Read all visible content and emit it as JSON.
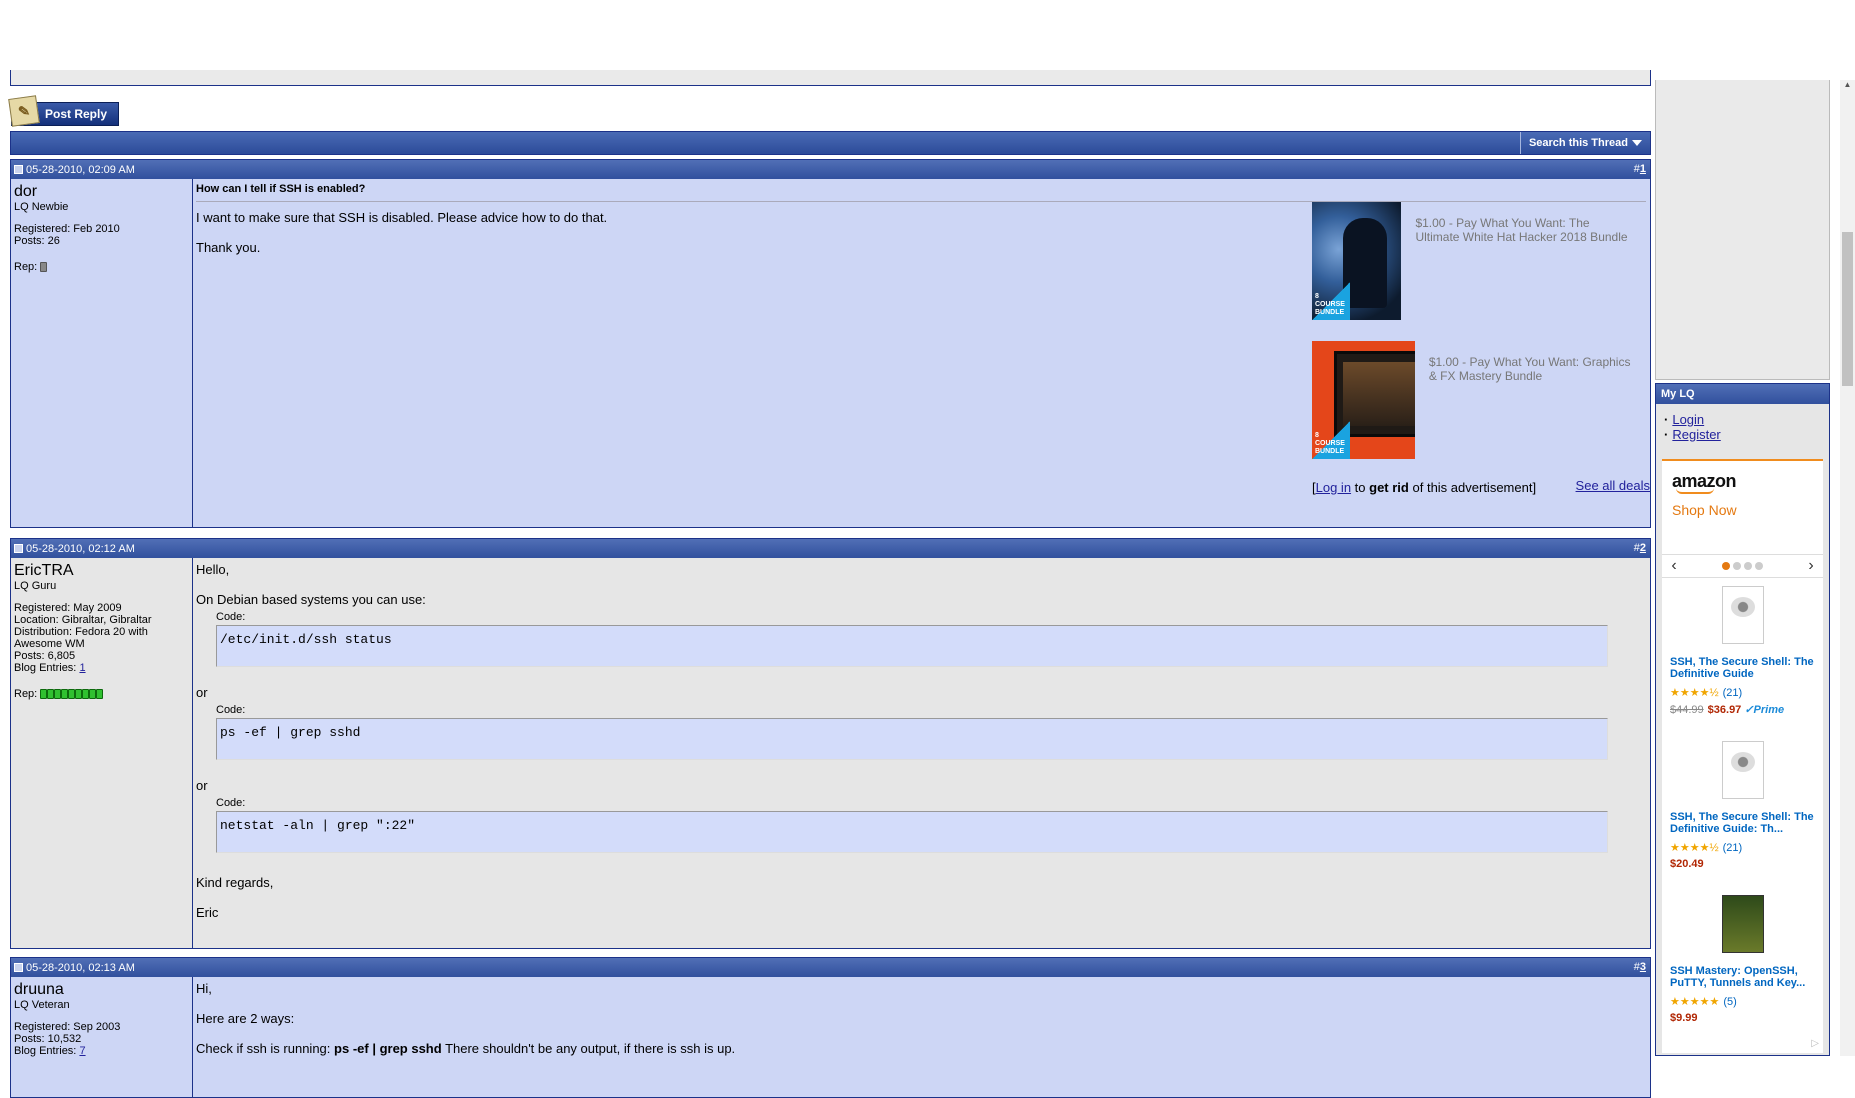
{
  "thread": {
    "post_reply_label": "Post Reply",
    "search_label": "Search this Thread"
  },
  "posts": [
    {
      "date": "05-28-2010, 02:09 AM",
      "number_prefix": "#",
      "number": "1",
      "user": {
        "name": "dor",
        "title": "LQ Newbie",
        "registered": "Registered: Feb 2010",
        "posts": "Posts: 26",
        "rep_label": "Rep:"
      },
      "title": "How can I tell if SSH is enabled?",
      "paragraphs": [
        "I want to make sure that SSH is disabled. Please advice how to do that.",
        "Thank you."
      ]
    },
    {
      "date": "05-28-2010, 02:12 AM",
      "number_prefix": "#",
      "number": "2",
      "user": {
        "name": "EricTRA",
        "title": "LQ Guru",
        "registered": "Registered: May 2009",
        "location": "Location: Gibraltar, Gibraltar",
        "distribution": "Distribution: Fedora 20 with Awesome WM",
        "posts": "Posts: 6,805",
        "blog_label": "Blog Entries:",
        "blog_count": "1",
        "rep_label": "Rep:"
      },
      "greeting": "Hello,",
      "intro": "On Debian based systems you can use:",
      "code_label": "Code:",
      "codes": [
        "/etc/init.d/ssh status",
        "ps -ef | grep sshd",
        "netstat -aln | grep \":22\""
      ],
      "or": "or",
      "closing": "Kind regards,",
      "signature": "Eric"
    },
    {
      "date": "05-28-2010, 02:13 AM",
      "number_prefix": "#",
      "number": "3",
      "user": {
        "name": "druuna",
        "title": "LQ Veteran",
        "registered": "Registered: Sep 2003",
        "posts": "Posts: 10,532",
        "blog_label": "Blog Entries:",
        "blog_count": "7"
      },
      "greeting": "Hi,",
      "line2": "Here are 2 ways:",
      "line3_pre": "Check if ssh is running:",
      "line3_cmd": "ps -ef | grep sshd",
      "line3_post": "There shouldn't be any output, if there is ssh is up."
    }
  ],
  "ads": {
    "items": [
      {
        "text": "$1.00 - Pay What You Want: The Ultimate White Hat Hacker 2018 Bundle",
        "badge": "8 COURSE BUNDLE"
      },
      {
        "text": "$1.00 - Pay What You Want: Graphics & FX Mastery Bundle",
        "badge": "8 COURSE BUNDLE"
      }
    ],
    "login_link": "Log in",
    "to": "to",
    "get_rid": "get rid",
    "of_ad": "of this advertisement]",
    "open_bracket": "[",
    "see_all": "See all deals"
  },
  "sidebar": {
    "mylq_title": "My LQ",
    "links": [
      "Login",
      "Register"
    ],
    "amazon": {
      "logo": "amazon",
      "shop_now": "Shop Now",
      "products": [
        {
          "title": "SSH, The Secure Shell: The Definitive Guide",
          "stars": "★★★★½",
          "reviews": "(21)",
          "old_price": "$44.99",
          "price": "$36.97",
          "prime": "✓Prime"
        },
        {
          "title": "SSH, The Secure Shell: The Definitive Guide: Th...",
          "stars": "★★★★½",
          "reviews": "(21)",
          "price": "$20.49"
        },
        {
          "title": "SSH Mastery: OpenSSH, PuTTY, Tunnels and Key...",
          "stars": "★★★★★",
          "reviews": "(5)",
          "price": "$9.99"
        }
      ]
    }
  },
  "colors": {
    "header_blue": "#31509d",
    "post_bg_odd": "#cdd6f5",
    "post_bg_even": "#e6e6e6",
    "border": "#1c3289"
  }
}
